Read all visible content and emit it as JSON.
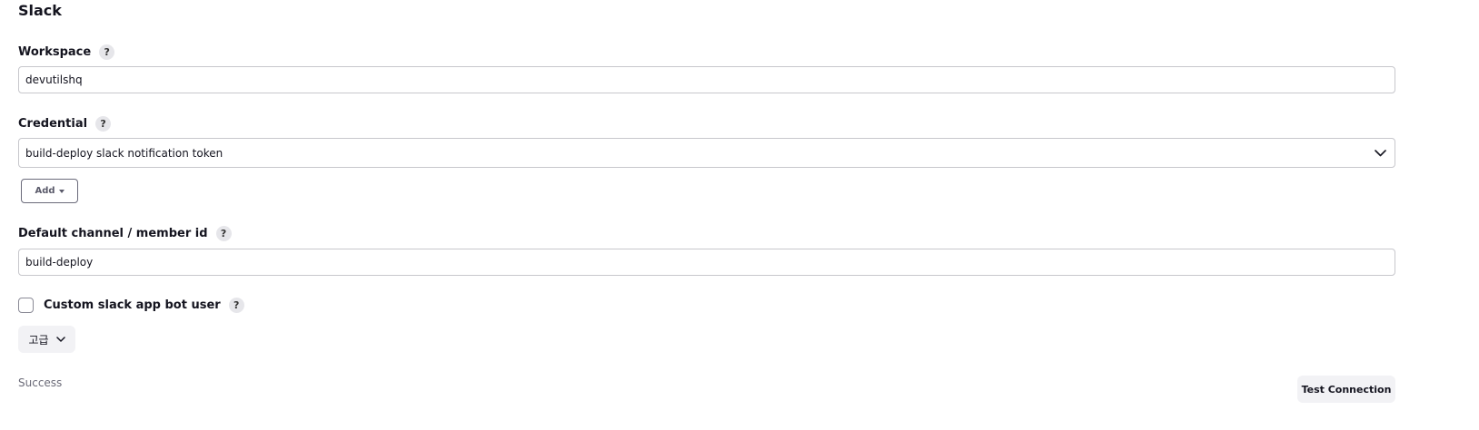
{
  "section": {
    "title": "Slack"
  },
  "workspace": {
    "label": "Workspace",
    "help": "?",
    "value": "devutilshq"
  },
  "credential": {
    "label": "Credential",
    "help": "?",
    "selected": "build-deploy slack notification token",
    "add_label": "Add",
    "chevron_icon": "chevron-down-icon",
    "add_caret_icon": "caret-down-icon"
  },
  "default_channel": {
    "label": "Default channel / member id",
    "help": "?",
    "value": "build-deploy"
  },
  "custom_bot_user": {
    "label": "Custom slack app bot user",
    "help": "?",
    "checked": false
  },
  "advanced": {
    "label": "고급",
    "chevron_icon": "chevron-down-icon"
  },
  "status": {
    "text": "Success"
  },
  "test_connection": {
    "label": "Test Connection"
  },
  "colors": {
    "border": "#c7c7cc",
    "help_bg": "#e6e6ea",
    "button_bg": "#f2f2f5",
    "status_text": "#6b6b78"
  }
}
